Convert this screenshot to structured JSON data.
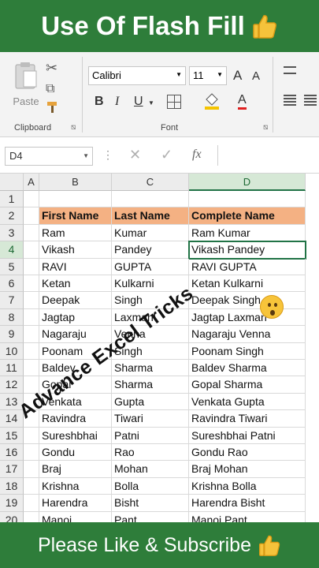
{
  "banner_top": {
    "title": "Use Of Flash Fill"
  },
  "banner_bottom": {
    "text": "Please Like & Subscribe"
  },
  "ribbon": {
    "clipboard": {
      "paste_label": "Paste",
      "group_label": "Clipboard"
    },
    "font": {
      "font_name": "Calibri",
      "font_size": "11",
      "bold": "B",
      "italic": "I",
      "underline": "U",
      "grow": "A",
      "shrink": "A",
      "font_color": "A",
      "group_label": "Font"
    }
  },
  "formula_bar": {
    "name_box": "D4",
    "fx": "fx"
  },
  "sheet": {
    "columns": [
      "A",
      "B",
      "C",
      "D"
    ],
    "rows": [
      {
        "n": "1",
        "b": "",
        "c": "",
        "d": ""
      },
      {
        "n": "2",
        "b": "First Name",
        "c": "Last Name",
        "d": "Complete Name"
      },
      {
        "n": "3",
        "b": "Ram",
        "c": "Kumar",
        "d": "Ram Kumar"
      },
      {
        "n": "4",
        "b": "Vikash",
        "c": "Pandey",
        "d": "Vikash Pandey"
      },
      {
        "n": "5",
        "b": "RAVI",
        "c": "GUPTA",
        "d": "RAVI GUPTA"
      },
      {
        "n": "6",
        "b": "Ketan",
        "c": "Kulkarni",
        "d": "Ketan Kulkarni"
      },
      {
        "n": "7",
        "b": "Deepak",
        "c": "Singh",
        "d": "Deepak Singh"
      },
      {
        "n": "8",
        "b": "Jagtap",
        "c": "Laxman",
        "d": "Jagtap Laxman"
      },
      {
        "n": "9",
        "b": "Nagaraju",
        "c": "Venna",
        "d": "Nagaraju Venna"
      },
      {
        "n": "10",
        "b": "Poonam",
        "c": "Singh",
        "d": "Poonam Singh"
      },
      {
        "n": "11",
        "b": "Baldev",
        "c": "Sharma",
        "d": "Baldev Sharma"
      },
      {
        "n": "12",
        "b": "Gopal",
        "c": "Sharma",
        "d": "Gopal Sharma"
      },
      {
        "n": "13",
        "b": "Venkata",
        "c": "Gupta",
        "d": "Venkata Gupta"
      },
      {
        "n": "14",
        "b": "Ravindra",
        "c": "Tiwari",
        "d": "Ravindra Tiwari"
      },
      {
        "n": "15",
        "b": "Sureshbhai",
        "c": "Patni",
        "d": "Sureshbhai Patni"
      },
      {
        "n": "16",
        "b": "Gondu",
        "c": "Rao",
        "d": "Gondu Rao"
      },
      {
        "n": "17",
        "b": "Braj",
        "c": "Mohan",
        "d": "Braj Mohan"
      },
      {
        "n": "18",
        "b": "Krishna",
        "c": "Bolla",
        "d": "Krishna Bolla"
      },
      {
        "n": "19",
        "b": "Harendra",
        "c": "Bisht",
        "d": "Harendra Bisht"
      },
      {
        "n": "20",
        "b": "Manoj",
        "c": "Pant",
        "d": "Manoj Pant"
      }
    ]
  },
  "overlay": {
    "text": "Advance Excel Tricks"
  }
}
